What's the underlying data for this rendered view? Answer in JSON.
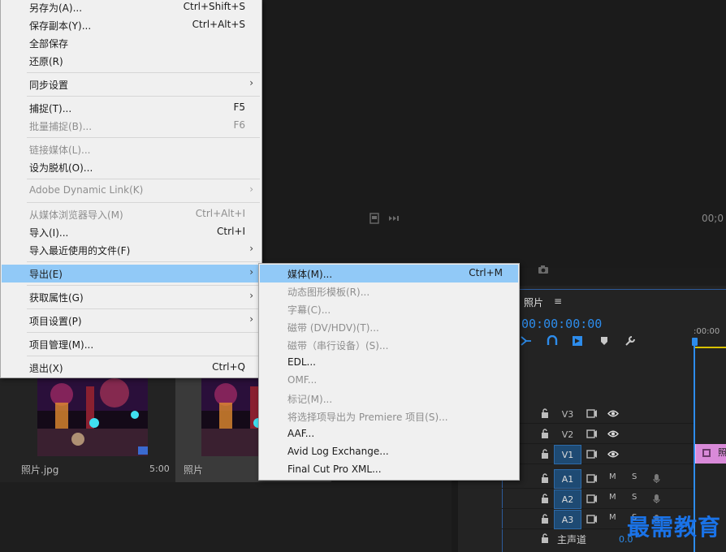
{
  "file_menu": {
    "items": [
      {
        "label": "另存为(A)...",
        "shortcut": "Ctrl+Shift+S"
      },
      {
        "label": "保存副本(Y)...",
        "shortcut": "Ctrl+Alt+S"
      },
      {
        "label": "全部保存",
        "shortcut": ""
      },
      {
        "label": "还原(R)",
        "shortcut": ""
      },
      {
        "label": "同步设置",
        "shortcut": ""
      },
      {
        "label": "捕捉(T)...",
        "shortcut": "F5"
      },
      {
        "label": "批量捕捉(B)...",
        "shortcut": "F6"
      },
      {
        "label": "链接媒体(L)...",
        "shortcut": ""
      },
      {
        "label": "设为脱机(O)...",
        "shortcut": ""
      },
      {
        "label": "Adobe Dynamic Link(K)",
        "shortcut": ""
      },
      {
        "label": "从媒体浏览器导入(M)",
        "shortcut": "Ctrl+Alt+I"
      },
      {
        "label": "导入(I)...",
        "shortcut": "Ctrl+I"
      },
      {
        "label": "导入最近使用的文件(F)",
        "shortcut": ""
      },
      {
        "label": "导出(E)",
        "shortcut": ""
      },
      {
        "label": "获取属性(G)",
        "shortcut": ""
      },
      {
        "label": "项目设置(P)",
        "shortcut": ""
      },
      {
        "label": "项目管理(M)...",
        "shortcut": ""
      },
      {
        "label": "退出(X)",
        "shortcut": "Ctrl+Q"
      }
    ],
    "submenu_arrow": "›"
  },
  "export_menu": {
    "items": [
      {
        "label": "媒体(M)...",
        "shortcut": "Ctrl+M"
      },
      {
        "label": "动态图形模板(R)...",
        "shortcut": ""
      },
      {
        "label": "字幕(C)...",
        "shortcut": ""
      },
      {
        "label": "磁带 (DV/HDV)(T)...",
        "shortcut": ""
      },
      {
        "label": "磁带（串行设备）(S)...",
        "shortcut": ""
      },
      {
        "label": "EDL...",
        "shortcut": ""
      },
      {
        "label": "OMF...",
        "shortcut": ""
      },
      {
        "label": "标记(M)...",
        "shortcut": ""
      },
      {
        "label": "将选择项导出为 Premiere 项目(S)...",
        "shortcut": ""
      },
      {
        "label": "AAF...",
        "shortcut": ""
      },
      {
        "label": "Avid Log Exchange...",
        "shortcut": ""
      },
      {
        "label": "Final Cut Pro XML...",
        "shortcut": ""
      }
    ]
  },
  "monitor": {
    "timecode": "00;0"
  },
  "project": {
    "items": [
      {
        "name": "照片.jpg",
        "duration": "5:00"
      },
      {
        "name": "照片",
        "duration": ""
      }
    ]
  },
  "timeline": {
    "sequence_name": "照片",
    "menu_glyph": "≡",
    "timecode": "00:00:00:00",
    "ruler_time": ":00:00",
    "video_tracks": [
      "V3",
      "V2",
      "V1"
    ],
    "audio_tracks": [
      "A1",
      "A2",
      "A3"
    ],
    "mute_label": "M",
    "solo_label": "S",
    "master_label": "主声道",
    "master_value": "0.0",
    "clip_label": "照"
  },
  "watermark": "最需教育",
  "colors": {
    "menu_bg": "#f0f0f0",
    "menu_highlight": "#91c9f7",
    "accent_blue": "#2d8ceb",
    "clip_pink": "#d98ad9",
    "track_on": "#1e4a73"
  }
}
